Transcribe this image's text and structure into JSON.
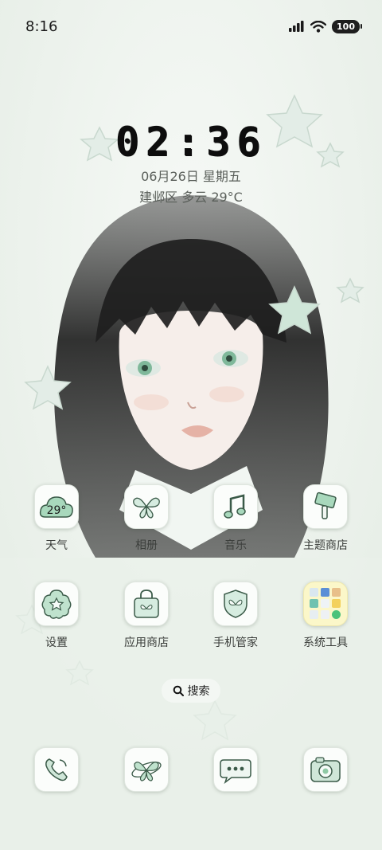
{
  "status_bar": {
    "time": "8:16",
    "battery": "100",
    "icons": [
      "signal-icon",
      "wifi-icon",
      "battery-icon"
    ]
  },
  "clock": {
    "time": "02:36",
    "date": "06月26日 星期五",
    "weather": "建邺区 多云 29°C"
  },
  "weather_widget_temp": "29°",
  "apps": [
    {
      "label": "天气",
      "icon": "weather-cloud-icon"
    },
    {
      "label": "相册",
      "icon": "butterfly-gallery-icon"
    },
    {
      "label": "音乐",
      "icon": "music-note-icon"
    },
    {
      "label": "主题商店",
      "icon": "paint-brush-icon"
    },
    {
      "label": "设置",
      "icon": "gear-flower-icon"
    },
    {
      "label": "应用商店",
      "icon": "shopping-bag-icon"
    },
    {
      "label": "手机管家",
      "icon": "shield-butterfly-icon"
    },
    {
      "label": "系统工具",
      "icon": "folder-grid-icon"
    }
  ],
  "search": {
    "label": "搜索"
  },
  "dock": [
    {
      "icon": "phone-icon"
    },
    {
      "icon": "butterfly-browser-icon"
    },
    {
      "icon": "message-bubble-icon"
    },
    {
      "icon": "camera-icon"
    }
  ],
  "colors": {
    "background": "#eef3ee",
    "accent_green": "#8fc9a5",
    "hair": "#2a2a2a"
  }
}
